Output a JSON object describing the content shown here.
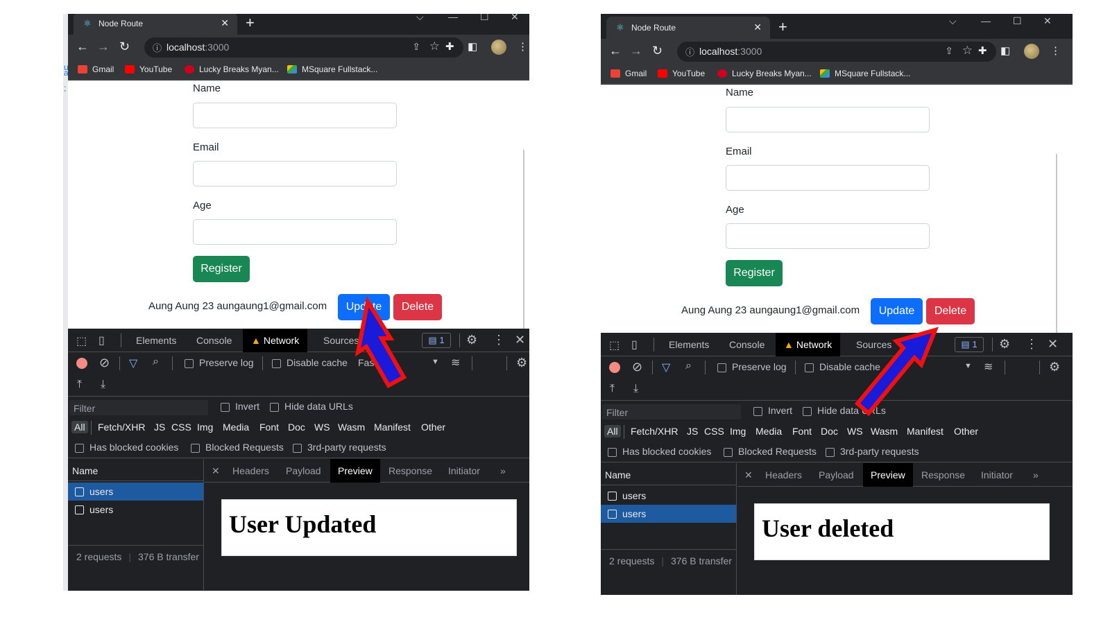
{
  "tab_title": "Node Route",
  "url_host": "localhost",
  "url_port": ":3000",
  "bookmarks": [
    "Gmail",
    "YouTube",
    "Lucky Breaks Myan...",
    "MSquare Fullstack..."
  ],
  "form": {
    "name_label": "Name",
    "email_label": "Email",
    "age_label": "Age",
    "register_label": "Register"
  },
  "user_row": {
    "text": "Aung Aung 23 aungaung1@gmail.com",
    "update_label": "Update",
    "delete_label": "Delete"
  },
  "devtools": {
    "tabs": [
      "Elements",
      "Console",
      "Network",
      "Sources"
    ],
    "active_tab": "Network",
    "issues_count": "1",
    "preserve_log": "Preserve log",
    "disable_cache": "Disable cache",
    "throttle": "Fas",
    "filter_placeholder": "Filter",
    "invert": "Invert",
    "hide_data_urls": "Hide data URLs",
    "types": [
      "All",
      "Fetch/XHR",
      "JS",
      "CSS",
      "Img",
      "Media",
      "Font",
      "Doc",
      "WS",
      "Wasm",
      "Manifest",
      "Other"
    ],
    "has_blocked_cookies": "Has blocked cookies",
    "blocked_requests": "Blocked Requests",
    "third_party": "3rd-party requests",
    "name_header": "Name",
    "requests": [
      "users",
      "users"
    ],
    "summary_requests": "2 requests",
    "summary_transfer": "376 B transfer",
    "detail_tabs": [
      "Headers",
      "Payload",
      "Preview",
      "Response",
      "Initiator"
    ],
    "active_detail_tab": "Preview",
    "more": "»"
  },
  "panels": [
    {
      "preview_text": "User Updated",
      "selected_request": 0,
      "arrow_target": "Update"
    },
    {
      "preview_text": "User deleted",
      "selected_request": 1,
      "arrow_target": "Delete"
    }
  ],
  "colors": {
    "register": "#198754",
    "update": "#0d6efd",
    "delete": "#dc3545",
    "arrow_fill": "#1a1adb",
    "arrow_outline": "#ee1111"
  },
  "icons": [
    "react-icon",
    "close-icon",
    "plus-icon",
    "back-icon",
    "forward-icon",
    "reload-icon",
    "info-icon",
    "share-icon",
    "star-icon",
    "extensions-icon",
    "sidepanel-icon",
    "gmail-icon",
    "youtube-icon",
    "coca-cola-icon",
    "drive-icon",
    "inspect-icon",
    "device-icon",
    "warning-icon",
    "chat-icon",
    "gear-icon",
    "kebab-icon",
    "record-icon",
    "clear-icon",
    "filter-icon",
    "search-icon",
    "wifi-icon",
    "upload-icon",
    "download-icon"
  ]
}
